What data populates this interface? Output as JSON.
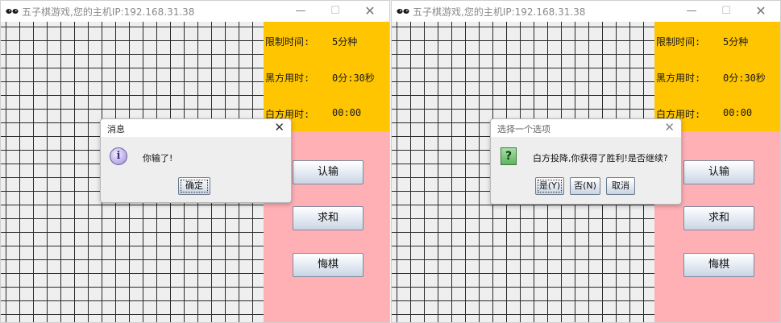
{
  "window_left": {
    "title": "五子棋游戏,您的主机IP:192.168.31.38",
    "controls": {
      "minimize": "—",
      "maximize": "☐",
      "close": "✕"
    },
    "info": {
      "limit_label": "限制时间:",
      "limit_value": "5分种",
      "black_label": "黑方用时:",
      "black_value": "0分:30秒",
      "white_label": "白方用时:",
      "white_value": "00:00"
    },
    "buttons": {
      "surrender": "认输",
      "draw": "求和",
      "undo": "悔棋"
    },
    "dialog": {
      "title": "消息",
      "close": "✕",
      "icon": "i",
      "message": "你输了!",
      "ok": "确定"
    }
  },
  "window_right": {
    "title": "五子棋游戏,您的主机IP:192.168.31.38",
    "controls": {
      "minimize": "—",
      "maximize": "☐",
      "close": "✕"
    },
    "info": {
      "limit_label": "限制时间:",
      "limit_value": "5分种",
      "black_label": "黑方用时:",
      "black_value": "0分:30秒",
      "white_label": "白方用时:",
      "white_value": "00:00"
    },
    "buttons": {
      "surrender": "认输",
      "draw": "求和",
      "undo": "悔棋"
    },
    "dialog": {
      "title": "选择一个选项",
      "close": "✕",
      "icon": "?",
      "message": "白方投降,你获得了胜利!是否继续?",
      "yes": "是(Y)",
      "no": "否(N)",
      "cancel": "取消"
    }
  },
  "colors": {
    "info_panel": "#ffc500",
    "button_panel": "#ffb0b5",
    "board": "#efefef",
    "grid": "#2a2a2a"
  }
}
